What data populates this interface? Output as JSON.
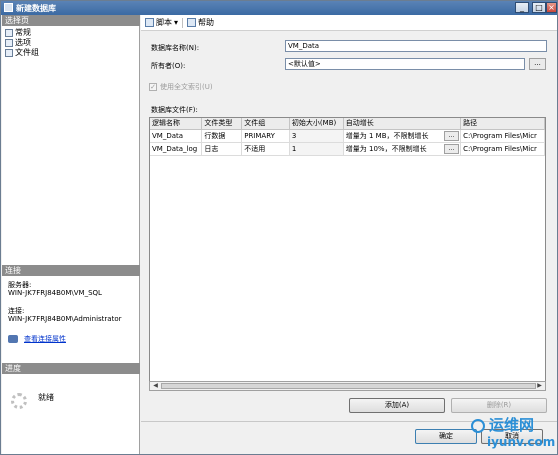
{
  "window": {
    "title": "新建数据库"
  },
  "left": {
    "select_page_header": "选择页",
    "pages": [
      "常规",
      "选项",
      "文件组"
    ],
    "connection_header": "连接",
    "server_label": "服务器:",
    "server_value": "WIN-JK7FRJ84B0M\\VM_SQL",
    "connection_label": "连接:",
    "connection_value": "WIN-JK7FRJ84B0M\\Administrator",
    "view_props_link": "查看连接属性",
    "progress_header": "进度",
    "progress_status": "就绪"
  },
  "toolbar": {
    "script_label": "脚本",
    "help_label": "帮助"
  },
  "form": {
    "db_name_label": "数据库名称(N):",
    "db_name_value": "VM_Data",
    "owner_label": "所有者(O):",
    "owner_value": "<默认值>",
    "fulltext_label": "使用全文索引(U)",
    "files_label": "数据库文件(F):"
  },
  "grid": {
    "columns": [
      "逻辑名称",
      "文件类型",
      "文件组",
      "初始大小(MB)",
      "自动增长",
      "路径"
    ],
    "rows": [
      [
        "VM_Data",
        "行数据",
        "PRIMARY",
        "3",
        "增量为 1 MB，不限制增长",
        "C:\\Program Files\\Micr"
      ],
      [
        "VM_Data_log",
        "日志",
        "不适用",
        "1",
        "增量为 10%，不限制增长",
        "C:\\Program Files\\Micr"
      ]
    ],
    "cell_button": "..."
  },
  "buttons": {
    "add": "添加(A)",
    "remove": "删除(R)",
    "ok": "确定",
    "cancel": "取消"
  },
  "watermark": {
    "cn": "运维网",
    "en": "iyunv.com"
  }
}
